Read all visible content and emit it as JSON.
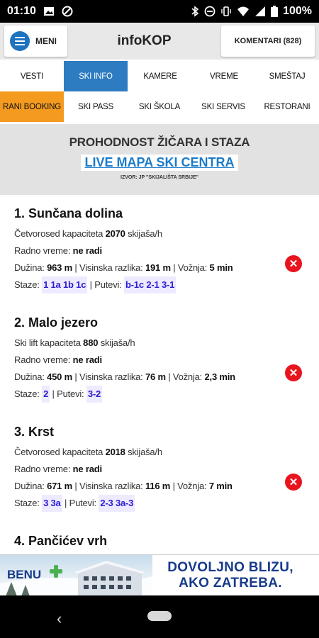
{
  "status_bar": {
    "time": "01:10",
    "battery": "100%"
  },
  "app_bar": {
    "menu_label": "MENI",
    "title": "infoKOP",
    "comments_label": "KOMENTARI (828)"
  },
  "tabs_row1": [
    "VESTI",
    "SKI INFO",
    "KAMERE",
    "VREME",
    "SMEŠTAJ"
  ],
  "tabs_row2": [
    "RANI BOOKING",
    "SKI PASS",
    "SKI ŠKOLA",
    "SKI SERVIS",
    "RESTORANI"
  ],
  "header": {
    "title": "PROHODNOST ŽIČARA I STAZA",
    "live_link": "LIVE MAPA SKI CENTRA",
    "source": "IZVOR: JP \"SKIJALIŠTA SRBIJE\""
  },
  "labels": {
    "radno_vreme": "Radno vreme:",
    "duzina": "Dužina:",
    "visinska": "| Visinska razlika:",
    "voznja": "| Vožnja:",
    "staze": "Staze:",
    "putevi": "| Putevi:",
    "skijasa": "skijaša/h"
  },
  "lifts": [
    {
      "name": "1. Sunčana dolina",
      "type": "Četvorosed kapaciteta",
      "capacity": "2070",
      "status": "ne radi",
      "length": "963 m",
      "height_diff": "191 m",
      "ride": "5 min",
      "slopes": "1 1a 1b 1c",
      "paths": "b-1c 2-1 3-1"
    },
    {
      "name": "2. Malo jezero",
      "type": "Ski lift kapaciteta",
      "capacity": "880",
      "status": "ne radi",
      "length": "450 m",
      "height_diff": "76 m",
      "ride": "2,3 min",
      "slopes": "2",
      "paths": "3-2"
    },
    {
      "name": "3. Krst",
      "type": "Četvorosed kapaciteta",
      "capacity": "2018",
      "status": "ne radi",
      "length": "671 m",
      "height_diff": "116 m",
      "ride": "7 min",
      "slopes": "3 3a",
      "paths": "2-3 3a-3"
    },
    {
      "name": "4. Pančićev vrh"
    }
  ],
  "ad": {
    "brand": "BENU",
    "line1": "DOVOLJNO BLIZU,",
    "line2": "AKO ZATREBA."
  },
  "colors": {
    "tab_active_blue": "#2d7bc1",
    "tab_active_orange": "#f39a1f",
    "status_closed": "#e8141e",
    "link": "#1a7bc9",
    "tag_text": "#2b1cd6"
  }
}
